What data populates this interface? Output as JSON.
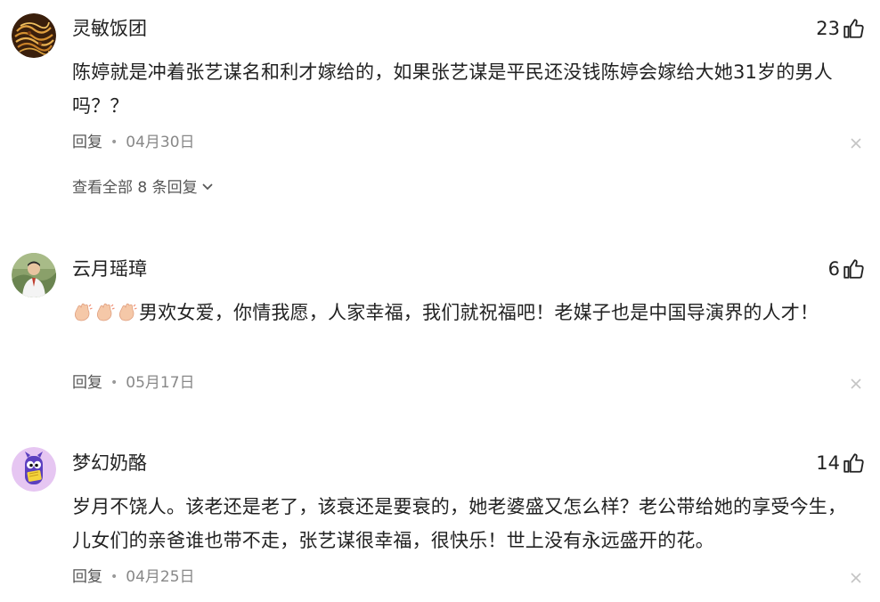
{
  "comments": [
    {
      "username": "灵敏饭团",
      "likes": "23",
      "text": "陈婷就是冲着张艺谋名和利才嫁给的，如果张艺谋是平民还没钱陈婷会嫁给大她31岁的男人吗？？",
      "reply_label": "回复",
      "date": "04月30日",
      "view_replies": "查看全部 8 条回复"
    },
    {
      "username": "云月瑶璋",
      "likes": "6",
      "text": "男欢女爱，你情我愿，人家幸福，我们就祝福吧！老媒子也是中国导演界的人才！",
      "reply_label": "回复",
      "date": "05月17日"
    },
    {
      "username": "梦幻奶酪",
      "likes": "14",
      "text": "岁月不饶人。该老还是老了，该衰还是要衰的，她老婆盛又怎么样？老公带给她的享受今生，儿女们的亲爸谁也带不走，张艺谋很幸福，很快乐！世上没有永远盛开的花。",
      "reply_label": "回复",
      "date": "04月25日"
    }
  ],
  "icons": {
    "like": "thumbs-up-icon",
    "close": "close-icon",
    "chevron": "chevron-down-icon",
    "clap": "clapping-hands-icon"
  }
}
